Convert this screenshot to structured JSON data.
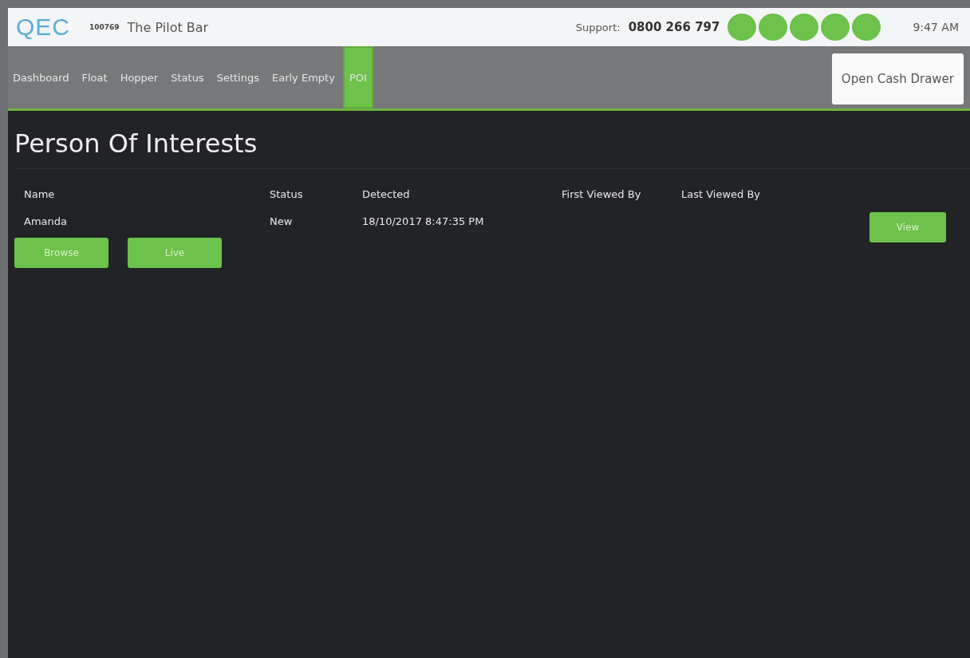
{
  "header": {
    "logo": "QEC",
    "store_id": "100769",
    "store_name": "The Pilot Bar",
    "support_label": "Support:",
    "support_phone": "0800 266 797",
    "status_lights": [
      {
        "color": "#6cc24a"
      },
      {
        "color": "#6cc24a"
      },
      {
        "color": "#6cc24a"
      },
      {
        "color": "#6cc24a"
      },
      {
        "color": "#6cc24a"
      }
    ],
    "time": "9:47 AM"
  },
  "nav": {
    "tabs": [
      {
        "label": "Dashboard",
        "selected": false
      },
      {
        "label": "Float",
        "selected": false
      },
      {
        "label": "Hopper",
        "selected": false
      },
      {
        "label": "Status",
        "selected": false
      },
      {
        "label": "Settings",
        "selected": false
      },
      {
        "label": "Early Empty",
        "selected": false
      },
      {
        "label": "POI",
        "selected": true
      }
    ],
    "action_button": "Open Cash Drawer"
  },
  "page": {
    "title": "Person Of Interests",
    "table": {
      "columns": [
        "Name",
        "Status",
        "Detected",
        "First Viewed By",
        "Last Viewed By"
      ],
      "rows": [
        {
          "cells": [
            "Amanda",
            "New",
            "18/10/2017 8:47:35 PM",
            "",
            ""
          ],
          "action": "View"
        }
      ]
    },
    "buttons": [
      "Browse",
      "Live"
    ]
  }
}
